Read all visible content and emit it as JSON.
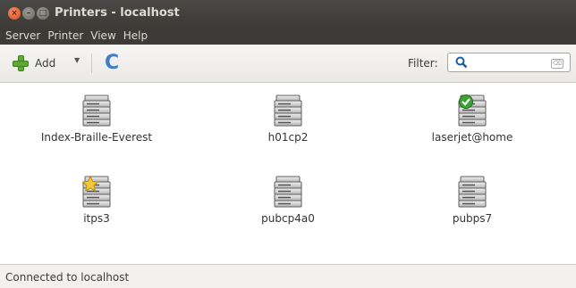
{
  "window": {
    "title": "Printers - localhost",
    "close_glyph": "×",
    "min_glyph": "–",
    "max_glyph": "□"
  },
  "menubar": {
    "items": [
      {
        "label": "Server"
      },
      {
        "label": "Printer"
      },
      {
        "label": "View"
      },
      {
        "label": "Help"
      }
    ]
  },
  "toolbar": {
    "add_label": "Add",
    "add_dropdown_glyph": "▼",
    "refresh_glyph": "C",
    "filter_label": "Filter:",
    "filter_value": "",
    "clear_glyph": "⌫"
  },
  "printers": [
    {
      "name": "Index-Braille-Everest",
      "badge": "none"
    },
    {
      "name": "h01cp2",
      "badge": "none"
    },
    {
      "name": "laserjet@home",
      "badge": "default-checkmark"
    },
    {
      "name": "itps3",
      "badge": "star"
    },
    {
      "name": "pubcp4a0",
      "badge": "none"
    },
    {
      "name": "pubps7",
      "badge": "none"
    }
  ],
  "status": {
    "text": "Connected to localhost"
  },
  "colors": {
    "title_bg": "#3c3b37",
    "close_button": "#df4a16",
    "accent_add": "#5fa832",
    "refresh": "#3d7fc9"
  }
}
